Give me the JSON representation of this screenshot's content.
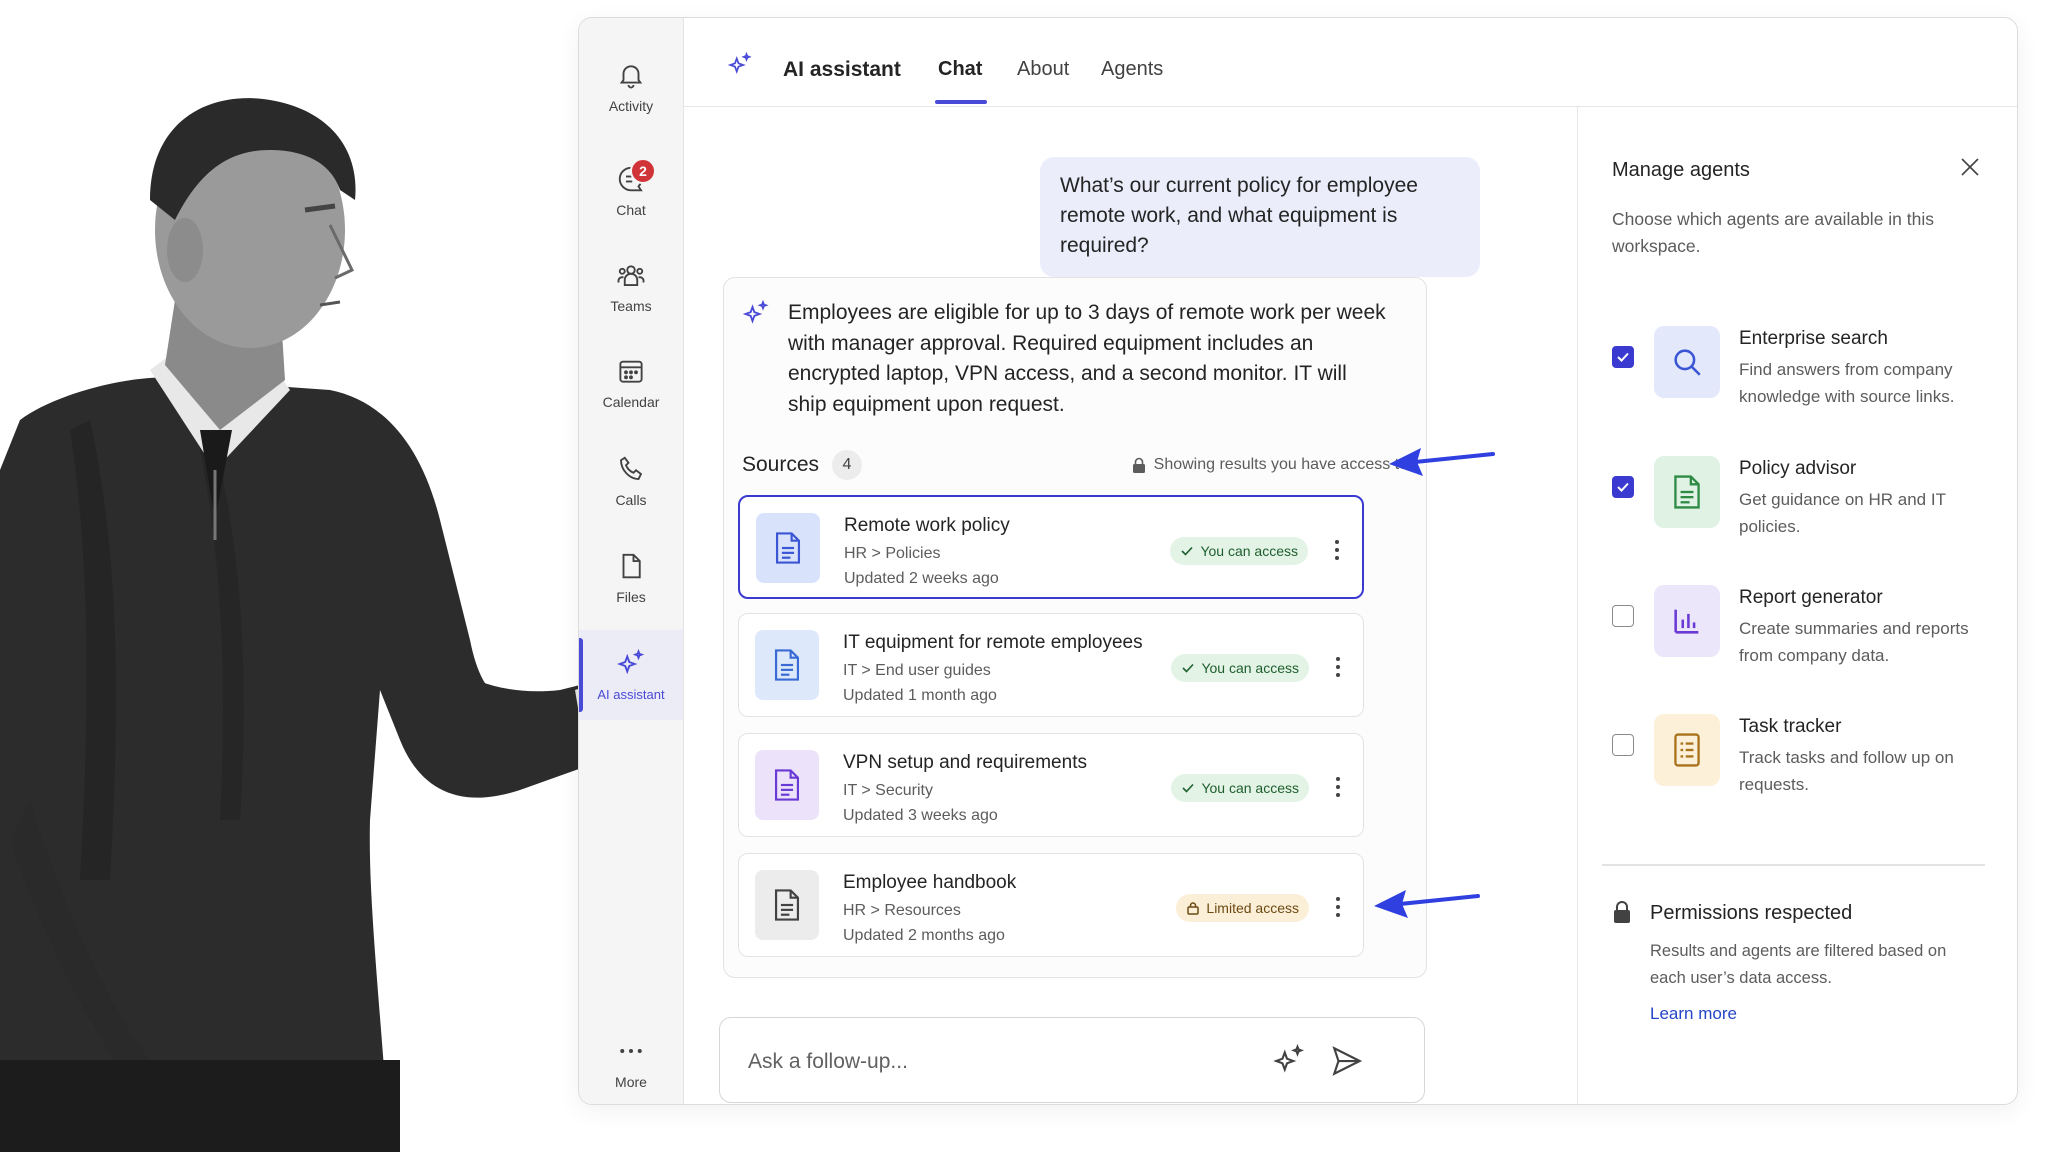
{
  "rail": {
    "items": [
      {
        "label": "Activity",
        "icon": "bell-icon"
      },
      {
        "label": "Chat",
        "icon": "chat-icon",
        "badge": "2"
      },
      {
        "label": "Teams",
        "icon": "teams-icon"
      },
      {
        "label": "Calendar",
        "icon": "calendar-icon"
      },
      {
        "label": "Calls",
        "icon": "phone-icon"
      },
      {
        "label": "Files",
        "icon": "file-icon"
      },
      {
        "label": "AI assistant",
        "icon": "sparkle-icon",
        "active": true
      }
    ],
    "more_label": "More"
  },
  "header": {
    "title": "AI assistant",
    "tabs": [
      {
        "label": "Chat",
        "active": true
      },
      {
        "label": "About"
      },
      {
        "label": "Agents"
      }
    ]
  },
  "chat": {
    "user_message": "What’s our current policy for employee remote work, and what equipment is required?",
    "answer": "Employees are eligible for up to 3 days of remote work per week with manager approval. Required equipment includes an encrypted laptop, VPN access, and a second monitor. IT will ship equipment upon request.",
    "sources_label": "Sources",
    "sources_count": "4",
    "access_note": "Showing results you have access to",
    "sources": [
      {
        "title": "Remote work policy",
        "path_a": "HR",
        "path_b": "Policies",
        "updated": "Updated 2 weeks ago",
        "access": "You can access",
        "status": "ok",
        "tile_color": "#d9e2fb",
        "icon_color": "#3a56d4"
      },
      {
        "title": "IT equipment for remote employees",
        "path_a": "IT",
        "path_b": "End user guides",
        "updated": "Updated 1 month ago",
        "access": "You can access",
        "status": "ok",
        "tile_color": "#dde9fb",
        "icon_color": "#3a6ad4"
      },
      {
        "title": "VPN setup and requirements",
        "path_a": "IT",
        "path_b": "Security",
        "updated": "Updated 3 weeks ago",
        "access": "You can access",
        "status": "ok",
        "tile_color": "#ece3fb",
        "icon_color": "#6a3ad4"
      },
      {
        "title": "Employee handbook",
        "path_a": "HR",
        "path_b": "Resources",
        "updated": "Updated 2 months ago",
        "access": "Limited access",
        "status": "limited",
        "tile_color": "#ececec",
        "icon_color": "#424242"
      }
    ],
    "followup_placeholder": "Ask a follow-up..."
  },
  "panel": {
    "title": "Manage agents",
    "description": "Choose which agents are available in this workspace.",
    "agents": [
      {
        "name": "Enterprise search",
        "desc": "Find answers from company knowledge with source links.",
        "checked": true,
        "icon": "search-icon",
        "tile_color": "#e3e8fb",
        "icon_color": "#3a56d4"
      },
      {
        "name": "Policy advisor",
        "desc": "Get guidance on HR and IT policies.",
        "checked": true,
        "icon": "document-icon",
        "tile_color": "#e0f2e4",
        "icon_color": "#2e8a45"
      },
      {
        "name": "Report generator",
        "desc": "Create summaries and reports from company data.",
        "checked": false,
        "icon": "bar-chart-icon",
        "tile_color": "#ece6fb",
        "icon_color": "#6a3ad4"
      },
      {
        "name": "Task tracker",
        "desc": "Track tasks and follow up on requests.",
        "checked": false,
        "icon": "checklist-icon",
        "tile_color": "#fcf0d8",
        "icon_color": "#a8721a"
      }
    ],
    "permissions_title": "Permissions respected",
    "permissions_desc": "Results and agents are filtered based on each user’s data access.",
    "learn_more": "Learn more"
  },
  "colors": {
    "accent": "#4a4ad8",
    "badge": "#d13438",
    "arrow": "#2f3fe0",
    "ok_pill": "#e3f3e6",
    "limited_pill": "#fcefd8"
  }
}
